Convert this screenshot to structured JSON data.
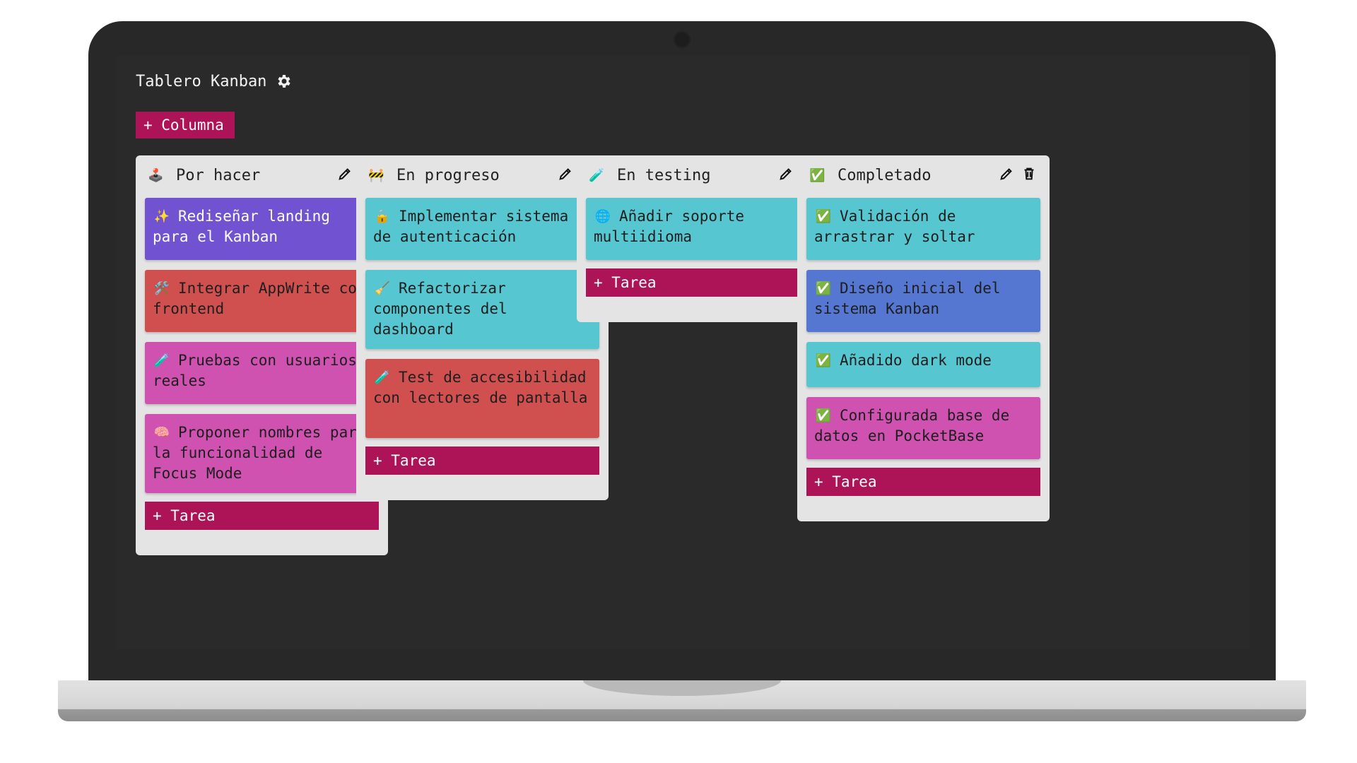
{
  "app": {
    "title": "Tablero Kanban",
    "settings_icon": "gear-icon",
    "add_column_label": "+ Columna"
  },
  "colors": {
    "accent": "#ad1457",
    "background": "#2a2a2a",
    "column_bg": "#e4e4e4",
    "purple": "#7152d0",
    "red": "#d05050",
    "pink": "#cf52b0",
    "teal": "#56c7d0",
    "blue": "#5577d2"
  },
  "columns": [
    {
      "emoji": "🕹️",
      "icon": "joystick-icon",
      "title": "Por hacer",
      "add_task_label": "+ Tarea",
      "cards": [
        {
          "emoji": "✨",
          "text": "Rediseñar landing para el Kanban",
          "color": "#7152d0"
        },
        {
          "emoji": "🛠️",
          "text": "Integrar AppWrite con frontend",
          "color": "#d05050"
        },
        {
          "emoji": "🧪",
          "text": "Pruebas con usuarios reales",
          "color": "#cf52b0"
        },
        {
          "emoji": "🧠",
          "text": "Proponer nombres para la funcionalidad de Focus Mode",
          "color": "#cf52b0"
        }
      ]
    },
    {
      "emoji": "🚧",
      "icon": "construction-icon",
      "title": "En progreso",
      "add_task_label": "+ Tarea",
      "cards": [
        {
          "emoji": "🔒",
          "text": "Implementar sistema de autenticación",
          "color": "#56c7d0"
        },
        {
          "emoji": "🧹",
          "text": "Refactorizar componentes del dashboard",
          "color": "#56c7d0"
        },
        {
          "emoji": "🧪",
          "text": "Test de accesibilidad con lectores de pantalla",
          "color": "#d05050"
        }
      ]
    },
    {
      "emoji": "🧪",
      "icon": "test-tube-icon",
      "title": "En testing",
      "add_task_label": "+ Tarea",
      "cards": [
        {
          "emoji": "🌐",
          "text": "Añadir soporte multiidioma",
          "color": "#56c7d0"
        }
      ]
    },
    {
      "emoji": "✅",
      "icon": "check-mark-icon",
      "title": "Completado",
      "add_task_label": "+ Tarea",
      "cards": [
        {
          "emoji": "✅",
          "text": "Validación de arrastrar y soltar",
          "color": "#56c7d0"
        },
        {
          "emoji": "✅",
          "text": "Diseño inicial del sistema Kanban",
          "color": "#5577d2"
        },
        {
          "emoji": "✅",
          "text": "Añadido dark mode",
          "color": "#56c7d0"
        },
        {
          "emoji": "✅",
          "text": "Configurada base de datos en PocketBase",
          "color": "#cf52b0"
        }
      ]
    }
  ]
}
